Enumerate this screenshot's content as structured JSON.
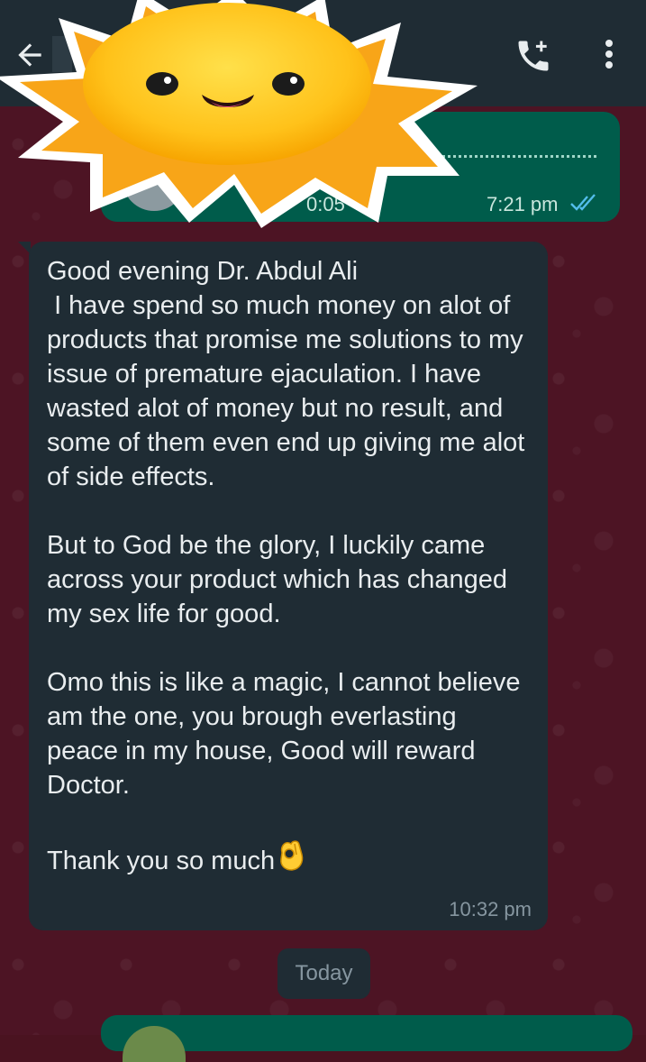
{
  "voice_message": {
    "duration": "0:05",
    "time": "7:21 pm",
    "status": "read"
  },
  "message": {
    "text": "Good evening Dr. Abdul Ali\n I have spend so much money on alot of products that promise me solutions to my issue of premature ejaculation. I have wasted alot of money but no result, and some of them even end up giving me alot of side effects.\n\nBut to God be the glory, I luckily came across your product which has changed my sex life for good.\n\nOmo this is like a magic, I cannot believe am the one, you brough everlasting peace in my house, Good will reward Doctor.\n\nThank you so much",
    "time": "10:32 pm"
  },
  "date_divider": "Today",
  "icons": {
    "back": "arrow-back-icon",
    "call": "add-call-icon",
    "menu": "more-vert-icon",
    "read_receipt": "double-check-icon",
    "emoji": "ok-hand-emoji",
    "sticker": "smiling-sun-sticker"
  },
  "colors": {
    "header": "#1f2c34",
    "outgoing_bubble": "#005c4b",
    "incoming_bubble": "#1f2c34",
    "read_check": "#53bdeb",
    "wallpaper": "#4d1424"
  }
}
